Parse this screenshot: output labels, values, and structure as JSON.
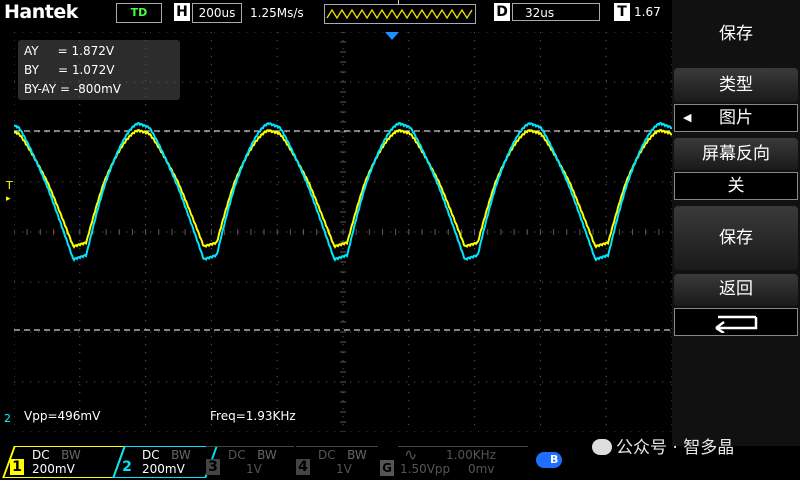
{
  "header": {
    "brand": "Hantek",
    "mode": "TD",
    "h_label": "H",
    "timebase": "200us",
    "sample_rate": "1.25Ms/s",
    "trigger_marker": "T",
    "d_label": "D",
    "delay": "32us",
    "t_label": "T",
    "trigger_level": "1.67"
  },
  "cursors": {
    "ay": "AY     = 1.872V",
    "by": "BY     = 1.072V",
    "delta": "BY-AY = -800mV"
  },
  "measurements": {
    "vpp": "Vpp=496mV",
    "freq": "Freq=1.93KHz"
  },
  "markers": {
    "trigger_level_marker": "T",
    "ch_ground_marker": "2"
  },
  "channels": [
    {
      "num": "1",
      "coupling": "DC",
      "bw": "BW",
      "scale": "200mV",
      "color": "#ffff00",
      "active": true
    },
    {
      "num": "2",
      "coupling": "DC",
      "bw": "BW",
      "scale": "200mV",
      "color": "#00e5ff",
      "active": true
    },
    {
      "num": "3",
      "coupling": "DC",
      "bw": "BW",
      "scale": "1V",
      "color": "#555555",
      "active": false
    },
    {
      "num": "4",
      "coupling": "DC",
      "bw": "BW",
      "scale": "1V",
      "color": "#555555",
      "active": false
    }
  ],
  "generator": {
    "label": "G",
    "wave": "∿",
    "freq": "1.00KHz",
    "amp": "1.50Vpp",
    "offset": "0mv"
  },
  "menu": {
    "title": "保存",
    "type_label": "类型",
    "type_value": "图片",
    "invert_label": "屏幕反向",
    "invert_value": "关",
    "save_label": "保存",
    "back_label": "返回"
  },
  "watermark": "公众号 · 智多晶",
  "colors": {
    "ch1": "#ffff00",
    "ch2": "#00e5ff",
    "grid": "#5a5a5a",
    "cursor": "#ffffff"
  }
}
